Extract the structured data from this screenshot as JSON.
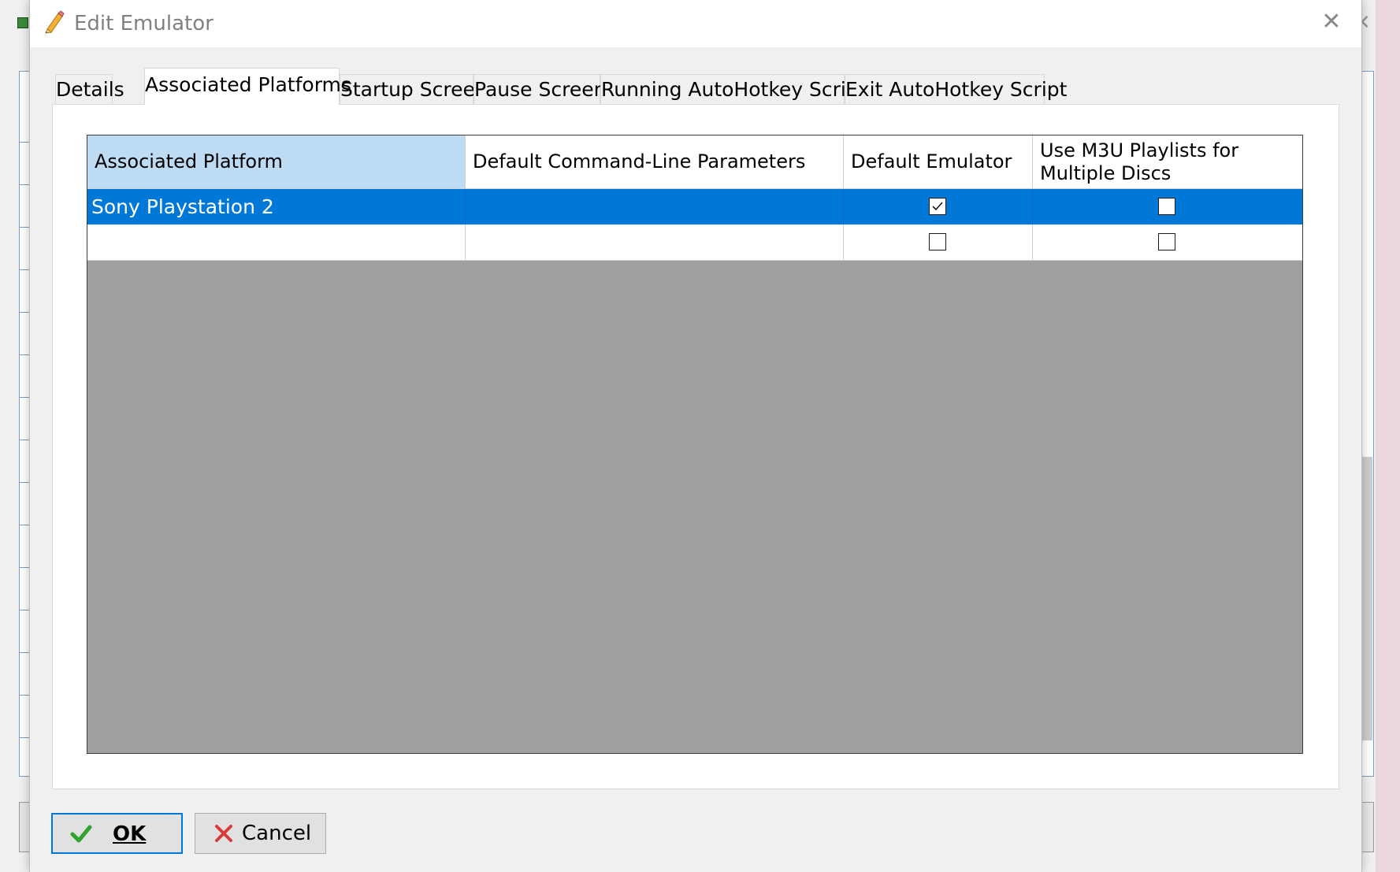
{
  "dialog": {
    "title": "Edit Emulator",
    "close_glyph": "✕",
    "title_icon": "pencil-icon"
  },
  "tabs": [
    {
      "label": "Details",
      "active": false
    },
    {
      "label": "Associated Platforms",
      "active": true
    },
    {
      "label": "Startup Screen",
      "active": false
    },
    {
      "label": "Pause Screen",
      "active": false
    },
    {
      "label": "Running AutoHotkey Script",
      "active": false
    },
    {
      "label": "Exit AutoHotkey Script",
      "active": false
    }
  ],
  "grid": {
    "columns": [
      "Associated Platform",
      "Default Command-Line Parameters",
      "Default Emulator",
      "Use M3U Playlists for Multiple Discs"
    ],
    "rows": [
      {
        "platform": "Sony Playstation 2",
        "params": "",
        "default_emulator": true,
        "use_m3u": false,
        "selected": true
      },
      {
        "platform": "",
        "params": "",
        "default_emulator": false,
        "use_m3u": false,
        "selected": false
      }
    ]
  },
  "buttons": {
    "ok_label": "OK",
    "cancel_label": "Cancel"
  },
  "colors": {
    "selection": "#0078d7",
    "header_selected": "#bddbf3",
    "grid_empty": "#a0a0a0",
    "ok_icon": "#2fa22f",
    "cancel_icon": "#d83a3a"
  }
}
